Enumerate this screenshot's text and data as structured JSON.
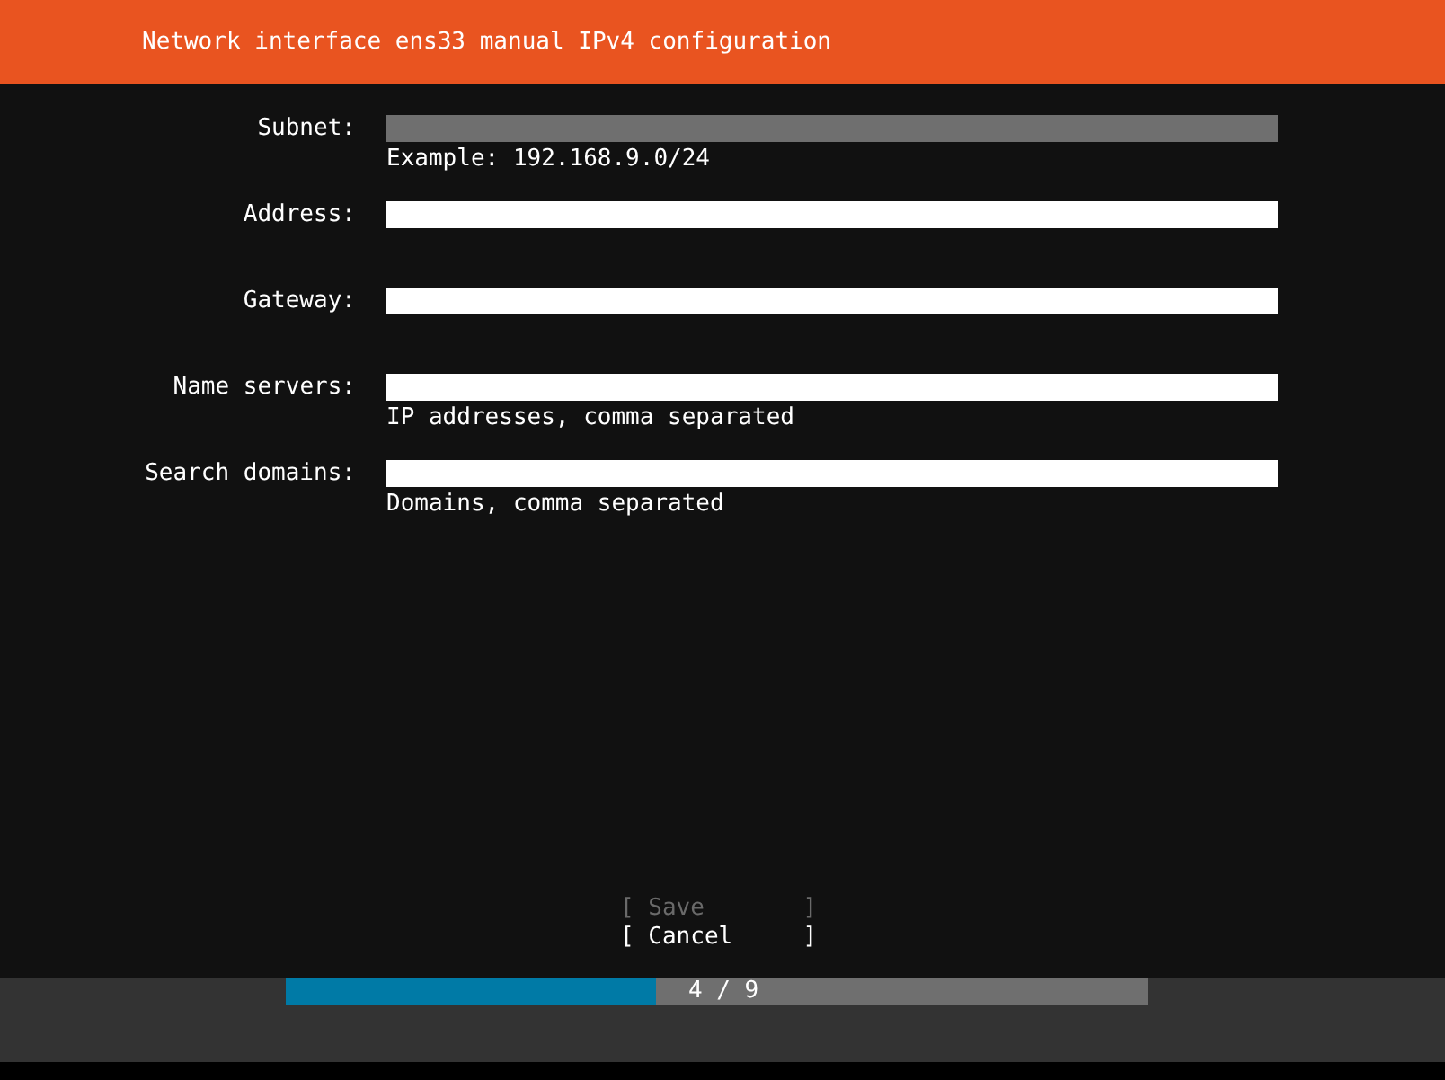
{
  "window": {
    "title": "Network interface ens33 manual IPv4 configuration"
  },
  "fields": [
    {
      "label": "Subnet:",
      "focused": true,
      "hint": "Example: 192.168.9.0/24"
    },
    {
      "label": "Address:",
      "focused": false
    },
    {
      "label": "Gateway:",
      "focused": false
    },
    {
      "label": "Name servers:",
      "focused": false,
      "hint": "IP addresses, comma separated"
    },
    {
      "label": "Search domains:",
      "focused": false,
      "hint": "Domains, comma separated"
    }
  ],
  "buttons": [
    {
      "label": "[ Save       ]",
      "disabled": true
    },
    {
      "label": "[ Cancel     ]",
      "disabled": false
    }
  ],
  "progress": {
    "level": 0.43,
    "text": "4 / 9"
  }
}
